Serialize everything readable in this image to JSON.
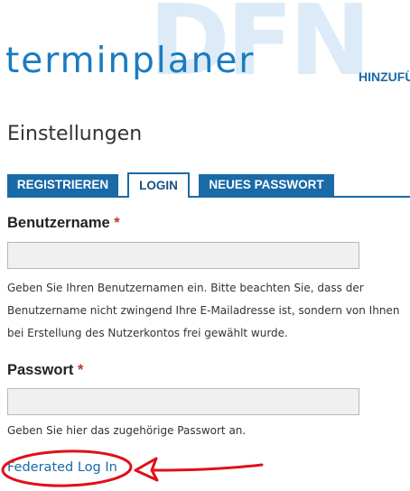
{
  "header": {
    "watermark": "DFN",
    "logo": "terminplaner",
    "nav_link": "HINZUFÜ"
  },
  "page": {
    "title": "Einstellungen"
  },
  "tabs": [
    {
      "label": "REGISTRIEREN",
      "active": false
    },
    {
      "label": "LOGIN",
      "active": true
    },
    {
      "label": "NEUES PASSWORT",
      "active": false
    }
  ],
  "form": {
    "username": {
      "label": "Benutzername",
      "required_mark": "*",
      "value": "",
      "help_lines": [
        "Geben Sie Ihren Benutzernamen ein. Bitte beachten Sie, dass der",
        "Benutzername nicht zwingend Ihre E-Mailadresse ist, sondern von Ihnen",
        "bei Erstellung des Nutzerkontos frei gewählt wurde."
      ]
    },
    "password": {
      "label": "Passwort",
      "required_mark": "*",
      "value": "",
      "help": "Geben Sie hier das zugehörige Passwort an."
    },
    "federated_link": "Federated Log In"
  },
  "colors": {
    "accent": "#1a6aa8",
    "logo": "#1a7cc1",
    "watermark": "#dcebf7",
    "annotation": "#e0101a"
  }
}
